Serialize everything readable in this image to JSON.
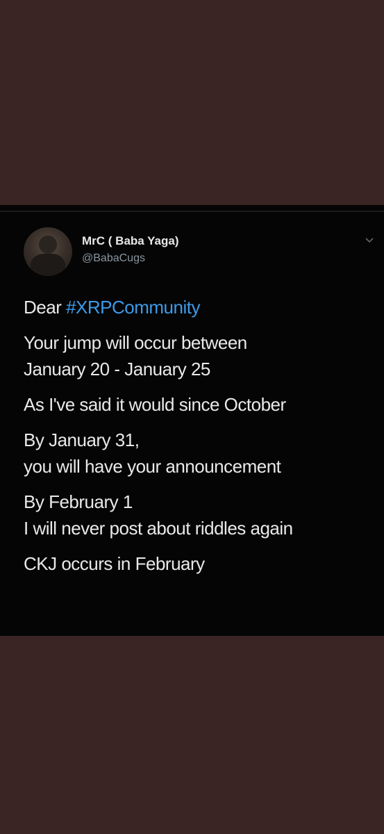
{
  "tweet": {
    "author": {
      "display_name": "MrC ( Baba Yaga)",
      "handle": "@BabaCugs"
    },
    "menu_icon": "chevron-down-icon",
    "greeting_prefix": "Dear ",
    "hashtag": "#XRPCommunity",
    "paragraphs": [
      [
        "Your jump will occur between",
        "January 20 - January 25"
      ],
      [
        "As I've said it would since October"
      ],
      [
        "By January 31,",
        "you will have your announcement"
      ],
      [
        "By February 1",
        "I will never post about riddles again"
      ],
      [
        "CKJ occurs in February"
      ]
    ]
  },
  "colors": {
    "page_background": "#3b2524",
    "card_background": "#050505",
    "text": "#e9e9e9",
    "handle": "#8b96a0",
    "hashtag": "#3d9be9"
  }
}
